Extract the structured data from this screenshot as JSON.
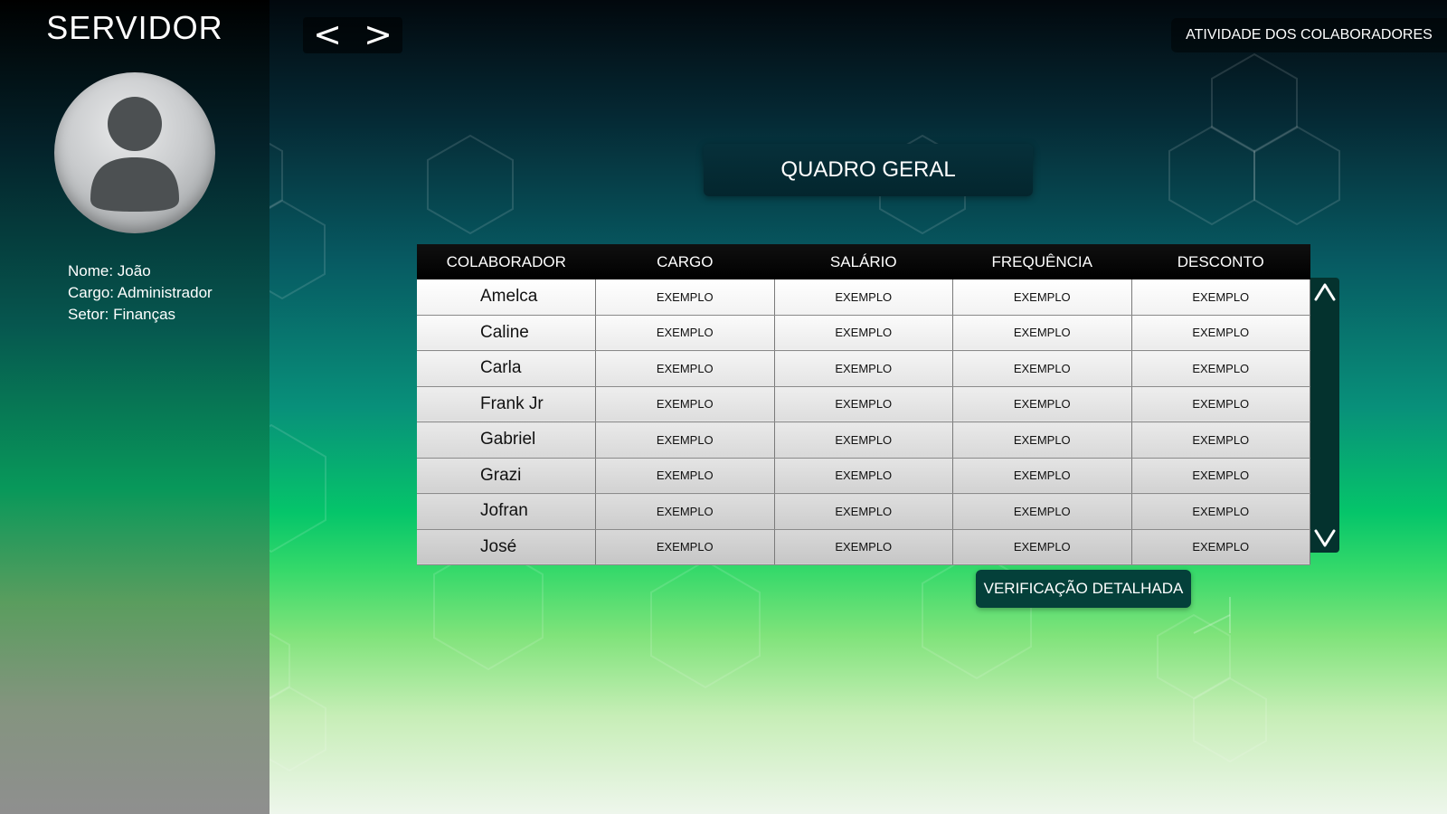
{
  "sidebar": {
    "title": "SERVIDOR",
    "user": {
      "name_label": "Nome: João",
      "role_label": "Cargo: Administrador",
      "sector_label": "Setor: Finanças"
    }
  },
  "nav": {
    "prev_label": "<",
    "next_label": ">"
  },
  "header": {
    "activity_button": "ATIVIDADE DOS COLABORADORES"
  },
  "main": {
    "title": "QUADRO GERAL",
    "table": {
      "columns": [
        "COLABORADOR",
        "CARGO",
        "SALÁRIO",
        "FREQUÊNCIA",
        "DESCONTO"
      ],
      "rows": [
        [
          "Amelca",
          "EXEMPLO",
          "EXEMPLO",
          "EXEMPLO",
          "EXEMPLO"
        ],
        [
          "Caline",
          "EXEMPLO",
          "EXEMPLO",
          "EXEMPLO",
          "EXEMPLO"
        ],
        [
          "Carla",
          "EXEMPLO",
          "EXEMPLO",
          "EXEMPLO",
          "EXEMPLO"
        ],
        [
          "Frank Jr",
          "EXEMPLO",
          "EXEMPLO",
          "EXEMPLO",
          "EXEMPLO"
        ],
        [
          "Gabriel",
          "EXEMPLO",
          "EXEMPLO",
          "EXEMPLO",
          "EXEMPLO"
        ],
        [
          "Grazi",
          "EXEMPLO",
          "EXEMPLO",
          "EXEMPLO",
          "EXEMPLO"
        ],
        [
          "Jofran",
          "EXEMPLO",
          "EXEMPLO",
          "EXEMPLO",
          "EXEMPLO"
        ],
        [
          "José",
          "EXEMPLO",
          "EXEMPLO",
          "EXEMPLO",
          "EXEMPLO"
        ]
      ]
    },
    "scroll": {
      "up_icon": "chevron-up-icon",
      "down_icon": "chevron-down-icon"
    },
    "detail_button": "VERIFICAÇÃO DETALHADA"
  },
  "colors": {
    "sidebar_top": "#000000",
    "accent_green": "#05c56a",
    "button_dark": "#04403a",
    "table_header": "#000000"
  }
}
